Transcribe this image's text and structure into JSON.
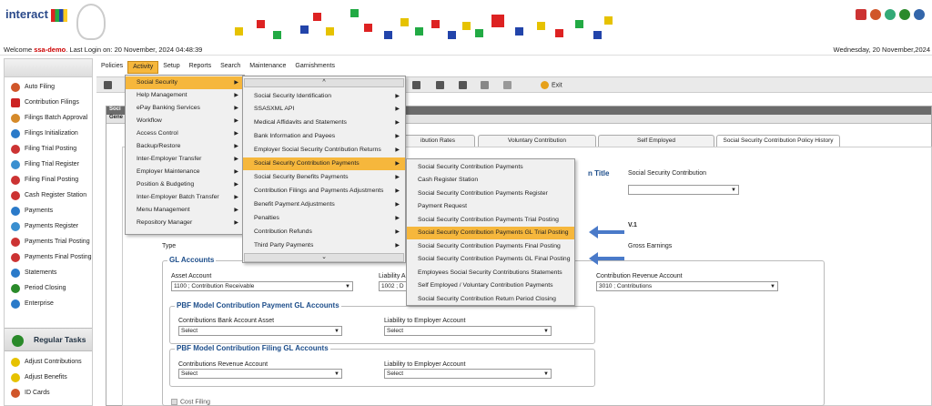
{
  "header": {
    "logo_text": "interact",
    "welcome_prefix": "Welcome ",
    "username": "ssa-demo",
    "last_login": ". Last Login on: 20 November, 2024 04:48:39",
    "date": "Wednesday, 20 November,2024"
  },
  "menubar": {
    "items": [
      "Policies",
      "Activity",
      "Setup",
      "Reports",
      "Search",
      "Maintenance",
      "Garnishments"
    ]
  },
  "toolbar": {
    "exit_label": "Exit"
  },
  "sidebar": {
    "items": [
      "Auto Filing",
      "Contribution Filings",
      "Filings Batch Approval",
      "Filings Initialization",
      "Filing Trial Posting",
      "Filing Trial Register",
      "Filing Final Posting",
      "Cash Register Station",
      "Payments",
      "Payments Register",
      "Payments Trial Posting",
      "Payments Final Posting",
      "Statements",
      "Period Closing",
      "Enterprise"
    ],
    "regular_tasks_title": "Regular Tasks",
    "tasks": [
      "Adjust Contributions",
      "Adjust Benefits",
      "ID Cards"
    ]
  },
  "activity_menu": {
    "items": [
      "Social Security",
      "Help Management",
      "ePay Banking Services",
      "Workflow",
      "Access Control",
      "Backup/Restore",
      "Inter-Employer Transfer",
      "Employer Maintenance",
      "Position & Budgeting",
      "Inter-Employer Batch Transfer",
      "Menu Management",
      "Repository Manager"
    ]
  },
  "social_security_menu": {
    "scroll_up": "^",
    "scroll_down": "⌄",
    "items": [
      "Social Security Identification",
      "SSASXML API",
      "Medical Affidavits and Statements",
      "Bank Information and Payees",
      "Employer Social Security Contribution Returns",
      "Social Security Contribution Payments",
      "Social Security Benefits Payments",
      "Contribution Filings and Payments Adjustments",
      "Benefit Payment Adjustments",
      "Penalties",
      "Contribution Refunds",
      "Third Party Payments"
    ]
  },
  "payments_menu": {
    "items": [
      "Social Security Contribution Payments",
      "Cash Register Station",
      "Social Security Contribution Payments Register",
      "Payment Request",
      "Social Security Contribution Payments Trial Posting",
      "Social Security Contribution Payments GL Trial Posting",
      "Social Security Contribution Payments Final Posting",
      "Social Security Contribution Payments GL Final Posting",
      "Employees Social Security Contributions Statements",
      "Self Employed / Voluntary Contribution Payments",
      "Social Security Contribution Return Period Closing"
    ]
  },
  "content": {
    "head_label": "Soci",
    "sub_label": "Gene",
    "tabs": [
      "ibution Rates",
      "Voluntary Contribution",
      "Self Employed",
      "Social Security Contribution Policy History"
    ],
    "n_title_fragment": "n Title",
    "title_value_label": "Social Security Contribution",
    "version": "V.1",
    "type_label": "Type",
    "gross_earnings": "Gross Earnings",
    "gl_accounts": "GL Accounts",
    "asset_account_label": "Asset Account",
    "asset_account_value": "1100 ; Contribution Receivable",
    "liability_label_fragment": "Liability A",
    "liability_value_fragment": "1002 ; D",
    "revenue_account_label": "Contribution Revenue Account",
    "revenue_account_value": "3010 ; Contributions",
    "pbf_payment_title": "PBF Model Contribution Payment GL Accounts",
    "contrib_bank_label": "Contributions Bank Account Asset",
    "liability_employer_label": "Liability to Employer Account",
    "select_placeholder": "Select",
    "pbf_filing_title": "PBF Model Contribution Filing GL Accounts",
    "contrib_revenue_label": "Contributions Revenue Account",
    "liability_employer_label2": "Liability to Employer Account",
    "cost_filing": "Cost Filing"
  }
}
